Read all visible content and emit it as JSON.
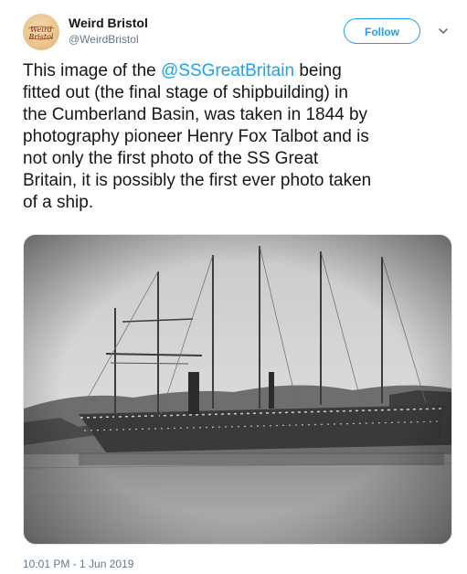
{
  "user": {
    "name": "Weird Bristol",
    "handle": "@WeirdBristol",
    "avatar_text": "Weird Bristol"
  },
  "follow": {
    "label": "Follow"
  },
  "caret_icon": "chevron-down-icon",
  "tweet": {
    "text_lines": [
      {
        "before": "This image of the ",
        "mention": "@SSGreatBritain",
        "after": " being"
      },
      {
        "before": "fitted out (the final stage of shipbuilding) in",
        "mention": "",
        "after": ""
      },
      {
        "before": "the Cumberland Basin, was taken in 1844 by",
        "mention": "",
        "after": ""
      },
      {
        "before": "photography pioneer Henry Fox Talbot and is",
        "mention": "",
        "after": ""
      },
      {
        "before": "not only the first photo of the SS Great",
        "mention": "",
        "after": ""
      },
      {
        "before": "Britain, it is possibly the first ever photo taken",
        "mention": "",
        "after": ""
      },
      {
        "before": "of a ship.",
        "mention": "",
        "after": ""
      }
    ]
  },
  "photo": {
    "subject": "historic-photograph-ship"
  },
  "timestamp": "10:01 PM - 1 Jun 2019",
  "colors": {
    "accent": "#1da1f2",
    "text": "#14171a",
    "muted": "#657786",
    "border": "#e1e8ed"
  }
}
